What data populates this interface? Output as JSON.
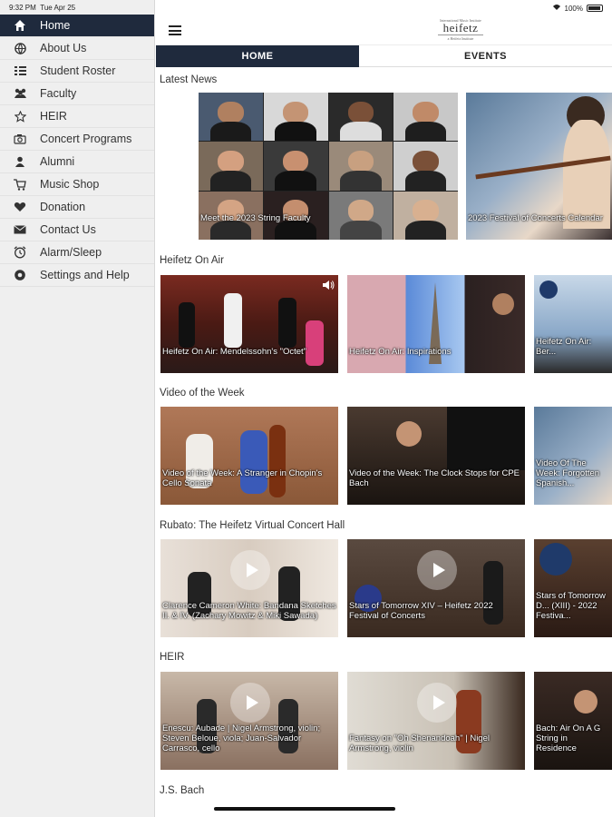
{
  "status": {
    "time": "9:32 PM",
    "date": "Tue Apr 25",
    "battery": "100%"
  },
  "sidebar": {
    "items": [
      {
        "label": "Home",
        "icon": "home-icon"
      },
      {
        "label": "About Us",
        "icon": "globe-icon"
      },
      {
        "label": "Student Roster",
        "icon": "list-icon"
      },
      {
        "label": "Faculty",
        "icon": "group-icon"
      },
      {
        "label": "HEIR",
        "icon": "star-icon"
      },
      {
        "label": "Concert Programs",
        "icon": "camera-icon"
      },
      {
        "label": "Alumni",
        "icon": "person-icon"
      },
      {
        "label": "Music Shop",
        "icon": "cart-icon"
      },
      {
        "label": "Donation",
        "icon": "heart-icon"
      },
      {
        "label": "Contact Us",
        "icon": "mail-icon"
      },
      {
        "label": "Alarm/Sleep",
        "icon": "alarm-icon"
      },
      {
        "label": "Settings and Help",
        "icon": "settings-icon"
      }
    ]
  },
  "header": {
    "logo_text": "heifetz",
    "logo_small_top": "International Music Institute",
    "logo_small_bottom": "a Heifetz Institute"
  },
  "tabs": [
    {
      "label": "HOME"
    },
    {
      "label": "EVENTS"
    }
  ],
  "sections": {
    "news": {
      "title": "Latest News",
      "cards": [
        {
          "caption": "Meet the 2023 String Faculty"
        },
        {
          "caption": "2023 Festival of Concerts Calendar"
        }
      ]
    },
    "on_air": {
      "title": "Heifetz On Air",
      "cards": [
        {
          "caption": "Heifetz On Air: Mendelssohn's \"Octet\""
        },
        {
          "caption": "Heifetz On Air: Inspirations"
        },
        {
          "caption": "Heifetz On Air: Ber..."
        }
      ]
    },
    "video_week": {
      "title": "Video of the Week",
      "cards": [
        {
          "caption": "Video of the Week: A Stranger in Chopin's Cello Sonata"
        },
        {
          "caption": "Video of the Week: The Clock Stops for CPE Bach"
        },
        {
          "caption": "Video Of The Week: Forgotten Spanish..."
        }
      ]
    },
    "rubato": {
      "title": "Rubato: The Heifetz Virtual Concert Hall",
      "cards": [
        {
          "caption": "Clarence Cameron White: Bandana Sketches II. & IV. (Zachary Mowitz & Miki Sawada)"
        },
        {
          "caption": "Stars of Tomorrow XIV – Heifetz 2022 Festival of Concerts"
        },
        {
          "caption": "Stars of Tomorrow D... (XIII) - 2022 Festiva..."
        }
      ]
    },
    "heir": {
      "title": "HEIR",
      "cards": [
        {
          "caption": "Enescu: Aubade | Nigel Armstrong, violin; Steven Beloue, viola; Juan-Salvador Carrasco, cello"
        },
        {
          "caption": "Fantasy on \"Oh Shenandoah\" | Nigel Armstrong, violin"
        },
        {
          "caption": "Bach: Air On A G String in Residence"
        }
      ]
    },
    "bach": {
      "title": "J.S. Bach"
    }
  }
}
